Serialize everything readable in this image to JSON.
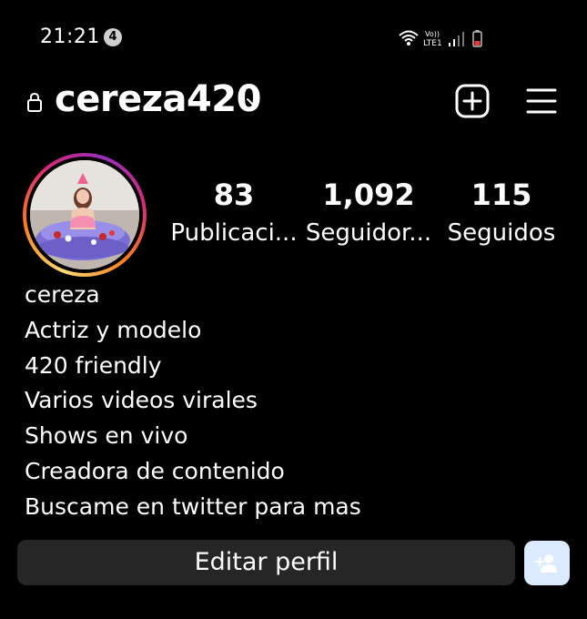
{
  "status_bar": {
    "time": "21:21",
    "notification_count": "4",
    "network_label_top": "Vo))",
    "network_label_bottom": "LTE1"
  },
  "header": {
    "username": "cereza420"
  },
  "stats": {
    "posts_count": "83",
    "posts_label": "Publicaci...",
    "followers_count": "1,092",
    "followers_label": "Seguidor...",
    "following_count": "115",
    "following_label": "Seguidos"
  },
  "bio": {
    "name": "cereza",
    "lines": [
      "Actriz y modelo",
      "420 friendly",
      "Varios videos virales",
      "Shows en vivo",
      "Creadora de contenido",
      "Buscame en twitter para mas"
    ]
  },
  "actions": {
    "edit_profile_label": "Editar perfil"
  },
  "colors": {
    "background": "#000000",
    "button_bg": "#262626",
    "discover_button_bg": "#dbeafe",
    "battery_red": "#e53935"
  },
  "icons": {
    "lock": "lock-icon",
    "chevron": "chevron-down-icon",
    "add": "add-post-icon",
    "menu": "hamburger-menu-icon",
    "discover": "add-person-icon"
  }
}
